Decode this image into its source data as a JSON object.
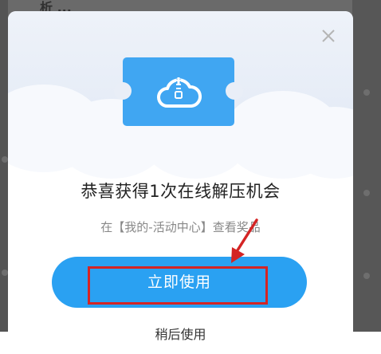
{
  "background": {
    "title_fragment": "析 ..."
  },
  "dialog": {
    "title": "恭喜获得1次在线解压机会",
    "subtitle": "在【我的-活动中心】查看奖品",
    "primary_button": "立即使用",
    "secondary_link": "稍后使用",
    "close_icon": "close-icon",
    "ticket_icon": "cloud-zip-icon"
  },
  "colors": {
    "accent": "#2aa1f2",
    "ticket": "#40a6f2",
    "highlight": "#d42424"
  }
}
